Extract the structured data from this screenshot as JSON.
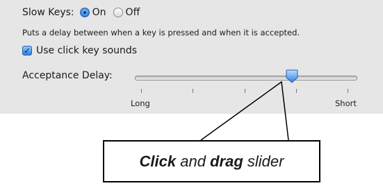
{
  "slow_keys": {
    "label": "Slow Keys:",
    "on_label": "On",
    "off_label": "Off",
    "selected": "On"
  },
  "description": "Puts a delay between when a key is pressed and when it is accepted.",
  "click_sounds": {
    "label": "Use click key sounds",
    "checked": true
  },
  "acceptance_delay": {
    "label": "Acceptance Delay:",
    "min_label": "Long",
    "max_label": "Short",
    "value_fraction": 0.72
  },
  "callout": {
    "word1": "Click",
    "word2": " and ",
    "word3": "drag",
    "word4": " slider"
  }
}
